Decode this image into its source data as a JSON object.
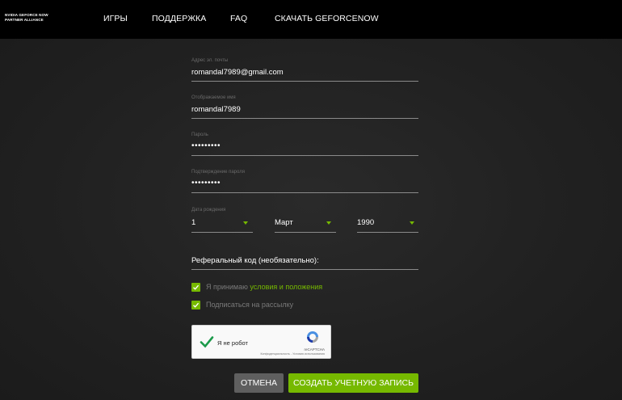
{
  "header": {
    "brand_line1": "NVIDIA GEFORCE NOW",
    "brand_line2": "PARTNER ALLIANCE",
    "nav": [
      "ИГРЫ",
      "ПОДДЕРЖКА",
      "FAQ",
      "СКАЧАТЬ GEFORCENOW"
    ]
  },
  "form": {
    "email": {
      "label": "Адрес эл. почты",
      "value": "romandal7989@gmail.com"
    },
    "display_name": {
      "label": "Отображаемое имя",
      "value": "romandal7989"
    },
    "password": {
      "label": "Пароль",
      "value": "•••••••••"
    },
    "password_confirm": {
      "label": "Подтверждение пароля",
      "value": "•••••••••"
    },
    "dob": {
      "label": "Дата рождения",
      "day": "1",
      "month": "Март",
      "year": "1990"
    },
    "referral": {
      "placeholder": "Реферальный код (необязательно):"
    },
    "terms": {
      "text": "Я принимаю ",
      "link": "условия и положения",
      "checked": true
    },
    "newsletter": {
      "text": "Подписаться на рассылку",
      "checked": true
    }
  },
  "captcha": {
    "label": "Я не робот",
    "brand": "reCAPTCHA",
    "terms": "Конфиденциальность - Условия использования"
  },
  "buttons": {
    "cancel": "ОТМЕНА",
    "create": "СОЗДАТЬ УЧЕТНУЮ ЗАПИСЬ"
  },
  "colors": {
    "accent": "#76b900",
    "header_bg": "#000000",
    "page_bg": "#1f1f1f"
  }
}
